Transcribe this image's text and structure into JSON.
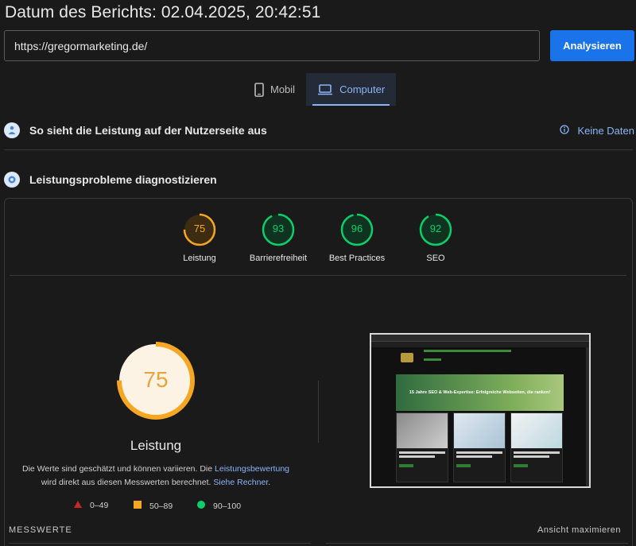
{
  "header": {
    "report_date": "Datum des Berichts: 02.04.2025, 20:42:51"
  },
  "url_bar": {
    "value": "https://gregormarketing.de/",
    "button_label": "Analysieren"
  },
  "device_tabs": [
    {
      "label": "Mobil",
      "icon": "smartphone-icon",
      "active": false
    },
    {
      "label": "Computer",
      "icon": "laptop-icon",
      "active": true
    }
  ],
  "field_data": {
    "title": "So sieht die Leistung auf der Nutzerseite aus",
    "no_data_label": "Keine Daten"
  },
  "diagnostics": {
    "title": "Leistungsprobleme diagnostizieren"
  },
  "scores": [
    {
      "label": "Leistung",
      "value": 75,
      "color": "#f5a623"
    },
    {
      "label": "Barrierefreiheit",
      "value": 93,
      "color": "#0cce6b"
    },
    {
      "label": "Best Practices",
      "value": 96,
      "color": "#0cce6b"
    },
    {
      "label": "SEO",
      "value": 92,
      "color": "#0cce6b"
    }
  ],
  "performance": {
    "score": 75,
    "title": "Leistung",
    "desc_part1": "Die Werte sind geschätzt und können variieren. Die ",
    "desc_link1": "Leistungsbewertung",
    "desc_part2": "wird direkt aus diesen Messwerten berechnet. ",
    "desc_link2": "Siehe Rechner",
    "desc_part3": "."
  },
  "legend": [
    {
      "range": "0–49",
      "shape": "triangle",
      "color": "#c62828"
    },
    {
      "range": "50–89",
      "shape": "square",
      "color": "#f5a623"
    },
    {
      "range": "90–100",
      "shape": "circle",
      "color": "#0cce6b"
    }
  ],
  "thumbnail": {
    "hero_text": "15 Jahre SEO & Web-Expertise: Erfolgreiche Webseiten, die ranken!"
  },
  "footer": {
    "metrics_label": "MESSWERTE",
    "maximize_label": "Ansicht maximieren"
  }
}
